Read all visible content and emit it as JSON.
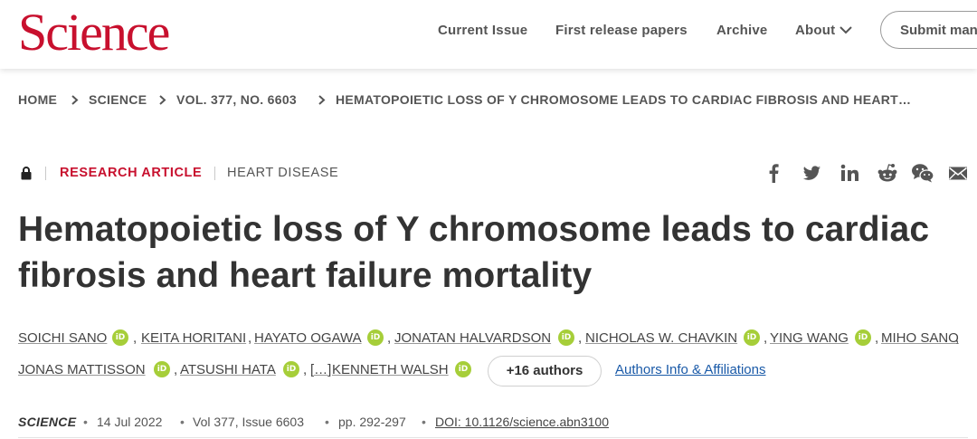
{
  "header": {
    "logo": "Science",
    "nav": [
      "Current Issue",
      "First release papers",
      "Archive",
      "About"
    ],
    "submit_label": "Submit manuscript"
  },
  "breadcrumb": [
    "HOME",
    "SCIENCE",
    "VOL. 377, NO. 6603",
    "HEMATOPOIETIC LOSS OF Y CHROMOSOME LEADS TO CARDIAC FIBROSIS AND HEART…"
  ],
  "article": {
    "type": "RESEARCH ARTICLE",
    "subject": "HEART DISEASE",
    "title": "Hematopoietic loss of Y chromosome leads to cardiac fibrosis and heart failure mortality",
    "authors": [
      "SOICHI SANO",
      "KEITA HORITANI",
      "HAYATO OGAWA",
      "JONATAN HALVARDSON",
      "NICHOLAS W. CHAVKIN",
      "YING WANG",
      "MIHO SANO",
      "JONAS MATTISSON",
      "ATSUSHI HATA",
      "[…]",
      "KENNETH WALSH"
    ],
    "more_authors": "+16 authors",
    "affiliations_link": "Authors Info & Affiliations"
  },
  "citation": {
    "journal": "SCIENCE",
    "date": "14 Jul 2022",
    "volume": "Vol 377, Issue 6603",
    "pages": "pp. 292-297",
    "doi": "DOI: 10.1126/science.abn3100"
  },
  "share_icons": [
    "facebook-icon",
    "twitter-icon",
    "linkedin-icon",
    "reddit-icon",
    "wechat-icon",
    "email-icon"
  ],
  "colors": {
    "brand_red": "#c8102e",
    "orcid_green": "#a6ce39",
    "link_blue": "#1a5aa8"
  }
}
